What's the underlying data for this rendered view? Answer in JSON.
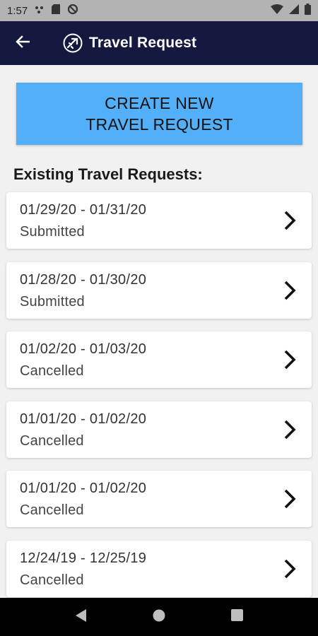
{
  "status_bar": {
    "time": "1:57",
    "icons": [
      "notification-dots-icon",
      "sd-card-icon",
      "sync-icon",
      "wifi-icon",
      "signal-icon",
      "battery-icon"
    ]
  },
  "app_bar": {
    "title": "Travel Request",
    "back_icon": "arrow-left-icon",
    "logo_icon": "airplane-badge-icon",
    "background_color": "#151940"
  },
  "create_button": {
    "label": "CREATE NEW\nTRAVEL REQUEST",
    "color": "#52aff8"
  },
  "section_heading": "Existing Travel Requests:",
  "requests": [
    {
      "dates": "01/29/20 - 01/31/20",
      "status": "Submitted"
    },
    {
      "dates": "01/28/20 - 01/30/20",
      "status": "Submitted"
    },
    {
      "dates": "01/02/20 - 01/03/20",
      "status": "Cancelled"
    },
    {
      "dates": "01/01/20 - 01/02/20",
      "status": "Cancelled"
    },
    {
      "dates": "01/01/20 - 01/02/20",
      "status": "Cancelled"
    },
    {
      "dates": "12/24/19 - 12/25/19",
      "status": "Cancelled"
    }
  ],
  "nav_bar": {
    "buttons": [
      "back-triangle-icon",
      "home-circle-icon",
      "recents-square-icon"
    ]
  }
}
